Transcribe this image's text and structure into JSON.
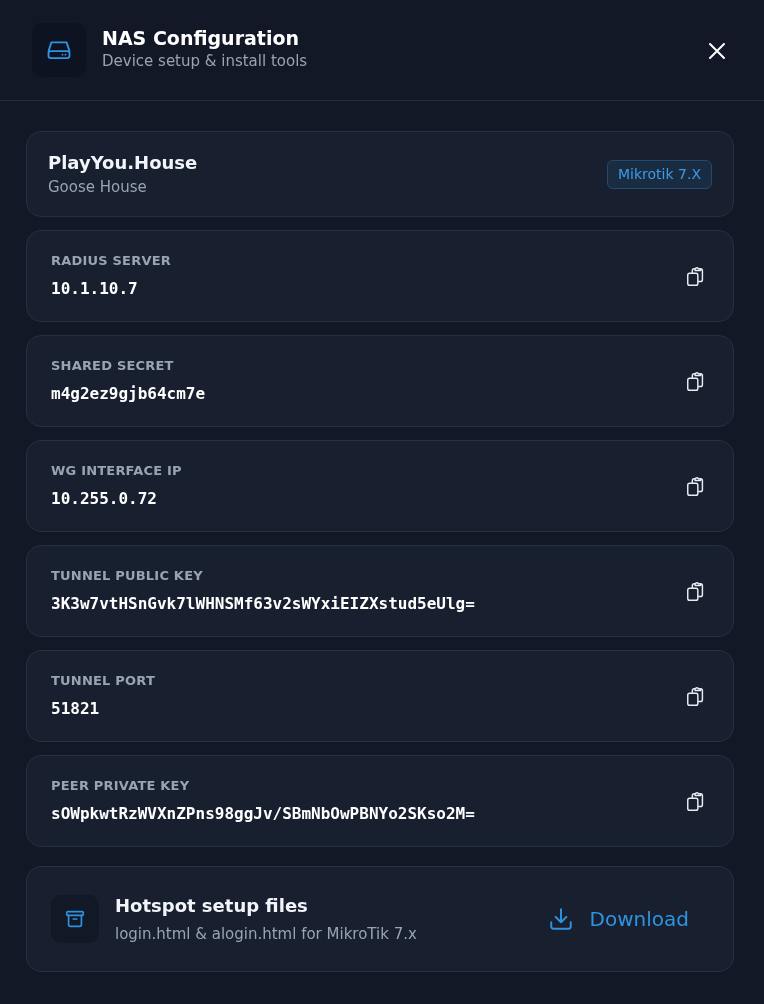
{
  "header": {
    "title": "NAS Configuration",
    "subtitle": "Device setup & install tools"
  },
  "device": {
    "name": "PlayYou.House",
    "location": "Goose House",
    "badge": "Mikrotik 7.X"
  },
  "fields": [
    {
      "label": "RADIUS SERVER",
      "value": "10.1.10.7"
    },
    {
      "label": "SHARED SECRET",
      "value": "m4g2ez9gjb64cm7e"
    },
    {
      "label": "WG INTERFACE IP",
      "value": "10.255.0.72"
    },
    {
      "label": "TUNNEL PUBLIC KEY",
      "value": "3K3w7vtHSnGvk7lWHNSMf63v2sWYxiEIZXstud5eUlg="
    },
    {
      "label": "TUNNEL PORT",
      "value": "51821"
    },
    {
      "label": "PEER PRIVATE KEY",
      "value": "sOWpkwtRzWVXnZPns98ggJv/SBmNbOwPBNYo2SKso2M="
    }
  ],
  "download": {
    "title": "Hotspot setup files",
    "subtitle": "login.html & alogin.html for MikroTik 7.x",
    "button": "Download"
  }
}
